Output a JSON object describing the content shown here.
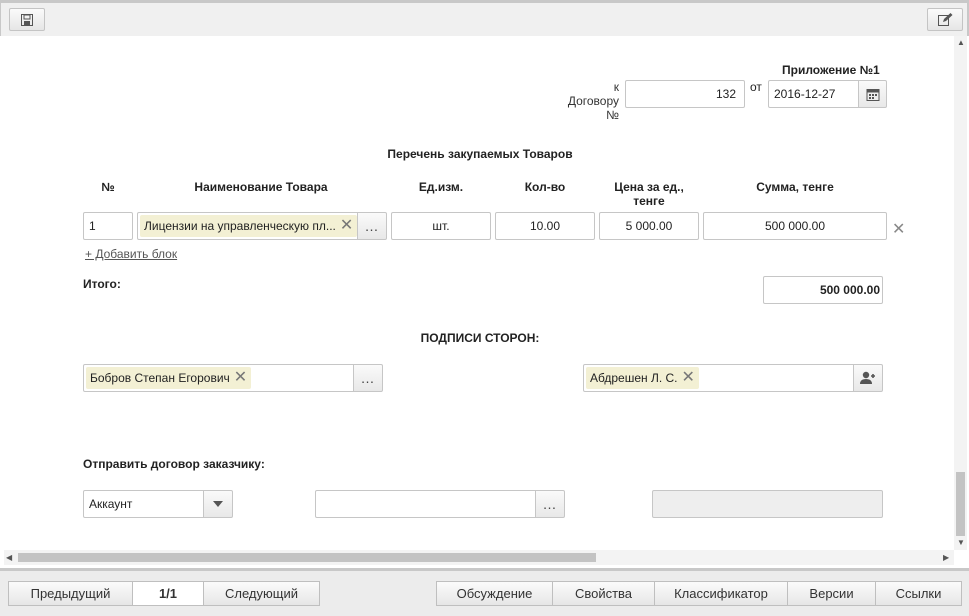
{
  "appendix": {
    "title": "Приложение №1"
  },
  "contract": {
    "label_line1": "к",
    "label_line2": "Договору",
    "label_line3": "№",
    "number": "132",
    "from_label": "от",
    "date": "2016-12-27"
  },
  "goods": {
    "title": "Перечень закупаемых Товаров",
    "columns": [
      "№",
      "Наименование Товара",
      "Ед.изм.",
      "Кол-во",
      "Цена за ед., тенге",
      "Сумма, тенге"
    ],
    "rows": [
      {
        "num": "1",
        "name": "Лицензии на управленческую пл...",
        "unit": "шт.",
        "qty": "10.00",
        "price": "5 000.00",
        "sum": "500 000.00"
      }
    ],
    "add_block": "+ Добавить блок",
    "total_label": "Итого:",
    "total_value": "500 000.00"
  },
  "signatures": {
    "title": "ПОДПИСИ СТОРОН:",
    "left_signer": "Бобров Степан Егорович",
    "right_signer": "Абдрешен Л. С."
  },
  "send": {
    "label": "Отправить договор заказчику:",
    "select_value": "Аккаунт",
    "input_value": "",
    "grey_value": ""
  },
  "bottom": {
    "prev": "Предыдущий",
    "page": "1/1",
    "next": "Следующий",
    "tabs": [
      "Обсуждение",
      "Свойства",
      "Классификатор",
      "Версии",
      "Ссылки"
    ]
  }
}
